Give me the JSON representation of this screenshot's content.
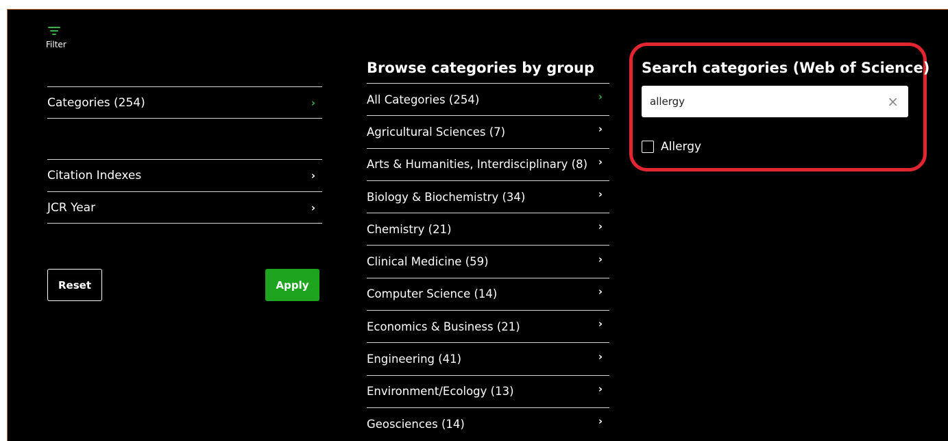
{
  "filter": {
    "label": "Filter",
    "icon": "filter-icon"
  },
  "left_panel": {
    "categories_label": "Categories (254)",
    "citation_indexes_label": "Citation Indexes",
    "jcr_year_label": "JCR Year",
    "reset_label": "Reset",
    "apply_label": "Apply"
  },
  "browse": {
    "title": "Browse categories by group",
    "items": [
      {
        "label": "All Categories (254)"
      },
      {
        "label": "Agricultural Sciences (7)"
      },
      {
        "label": "Arts & Humanities, Interdisciplinary (8)"
      },
      {
        "label": "Biology & Biochemistry (34)"
      },
      {
        "label": "Chemistry (21)"
      },
      {
        "label": "Clinical Medicine (59)"
      },
      {
        "label": "Computer Science (14)"
      },
      {
        "label": "Economics & Business (21)"
      },
      {
        "label": "Engineering (41)"
      },
      {
        "label": "Environment/Ecology (13)"
      },
      {
        "label": "Geosciences (14)"
      }
    ]
  },
  "search": {
    "title": "Search categories (Web of Science)",
    "value": "allergy",
    "clear_symbol": "×",
    "results": [
      {
        "label": "Allergy",
        "checked": false
      }
    ]
  },
  "colors": {
    "accent_green": "#38b34a",
    "apply_green": "#1fa41f",
    "highlight_red": "#e2252f",
    "background": "#000000"
  }
}
